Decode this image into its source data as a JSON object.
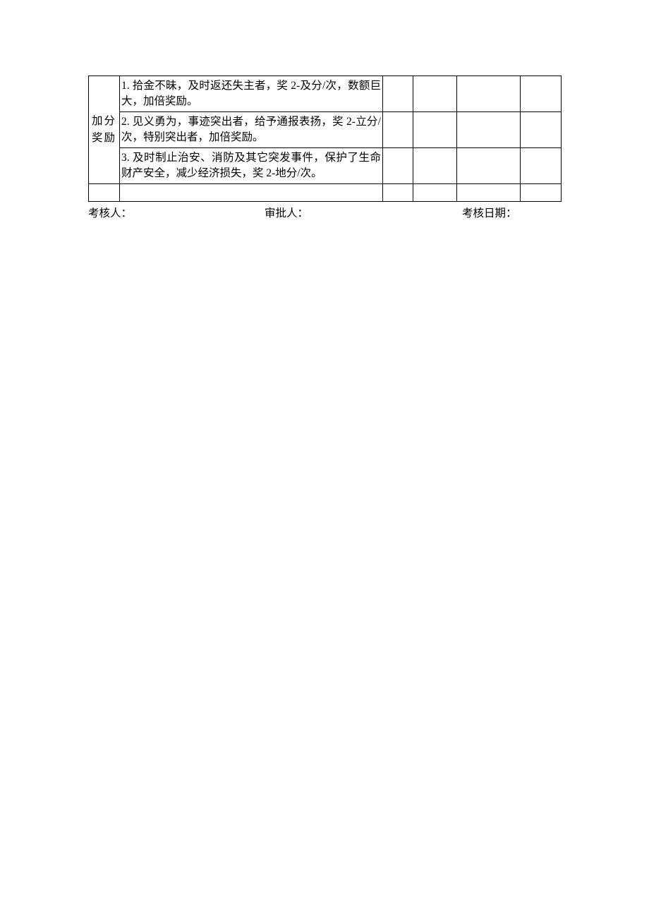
{
  "table": {
    "categoryLabel": "加分奖励",
    "rows": [
      "1. 拾金不昧，及时返还失主者，奖 2-及分/次，数额巨大，加倍奖励。",
      "2. 见义勇为，事迹突出者，给予通报表扬，奖 2-立分/次，特别突出者，加倍奖励。",
      "3. 及时制止治安、消防及其它突发事件，保护了生命财产安全，减少经济损失，奖 2-地分/次。"
    ]
  },
  "signatures": {
    "assessor": "考核人：",
    "approver": "审批人：",
    "date": "考核日期："
  }
}
